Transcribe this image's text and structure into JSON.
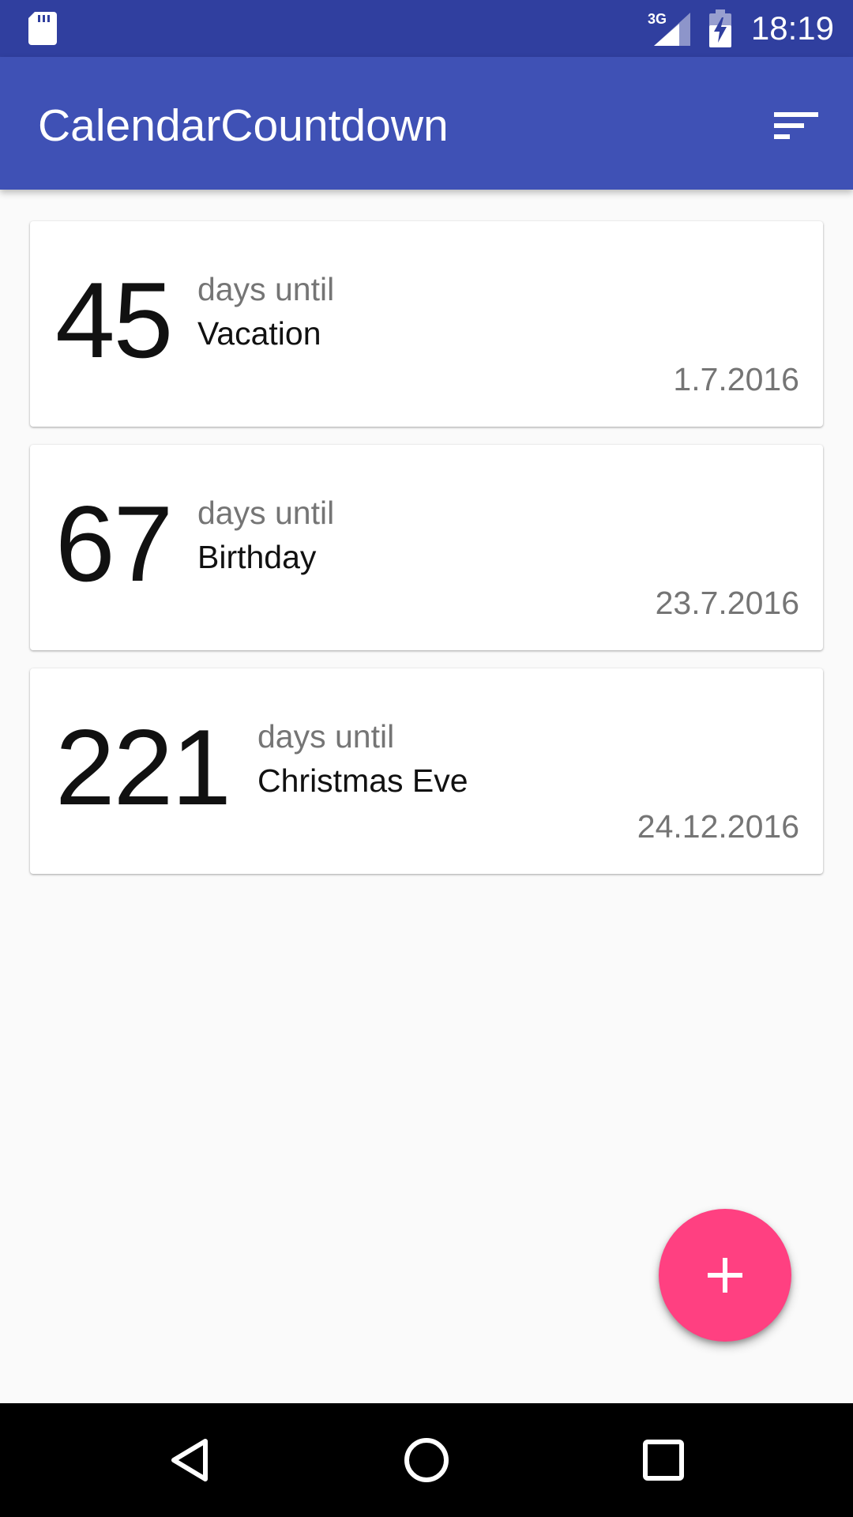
{
  "status_bar": {
    "time": "18:19",
    "network_label": "3G",
    "icons": [
      "sd-card-icon",
      "signal-icon",
      "battery-charging-icon"
    ]
  },
  "app_bar": {
    "title": "CalendarCountdown",
    "action_icon": "sort-icon"
  },
  "events": [
    {
      "count": "45",
      "until_label": "days until",
      "name": "Vacation",
      "date": "1.7.2016"
    },
    {
      "count": "67",
      "until_label": "days until",
      "name": "Birthday",
      "date": "23.7.2016"
    },
    {
      "count": "221",
      "until_label": "days until",
      "name": "Christmas Eve",
      "date": "24.12.2016"
    }
  ],
  "fab": {
    "icon": "plus-icon"
  },
  "nav_bar": {
    "icons": [
      "back-icon",
      "home-icon",
      "recents-icon"
    ]
  },
  "colors": {
    "status_bar": "#303f9f",
    "app_bar": "#3f51b5",
    "accent": "#ff4081",
    "background": "#fafafa"
  }
}
